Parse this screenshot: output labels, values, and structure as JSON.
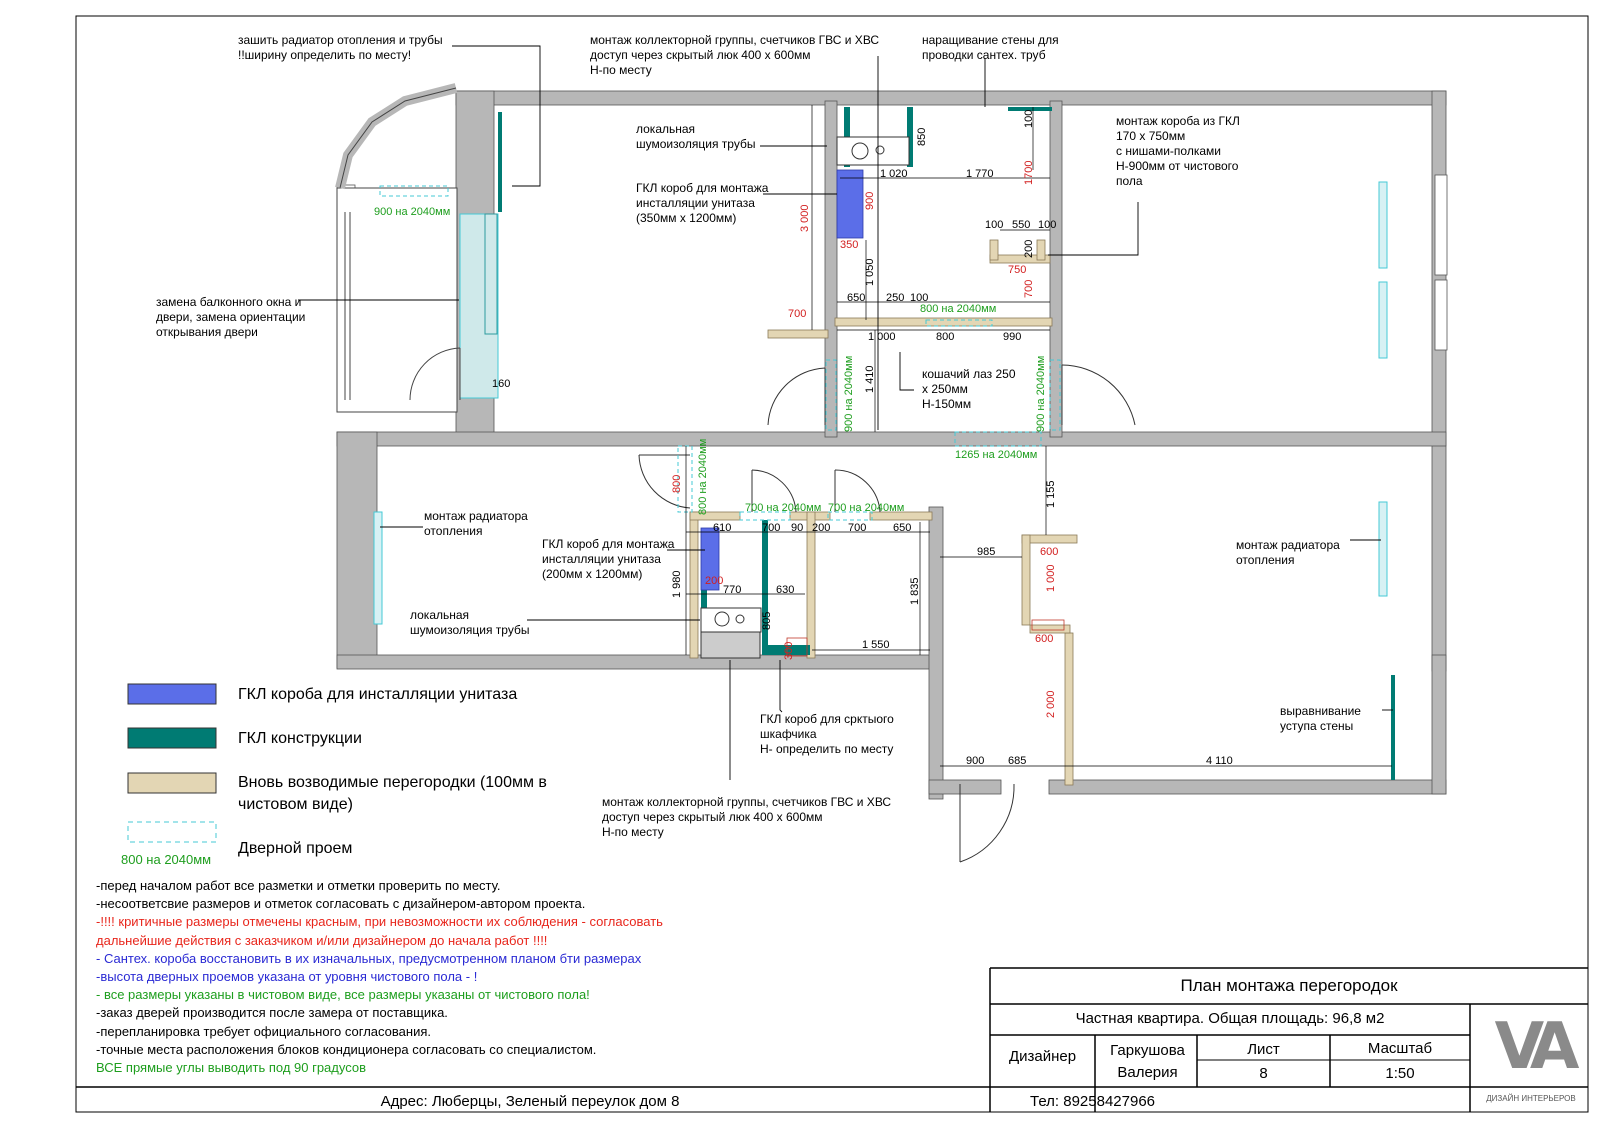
{
  "title_block": {
    "title": "План монтажа перегородок",
    "subtitle": "Частная квартира. Общая площадь: 96,8 м2",
    "designer_label": "Дизайнер",
    "designer_name": "Гаркушова Валерия",
    "sheet_label": "Лист",
    "sheet_value": "8",
    "scale_label": "Масштаб",
    "scale_value": "1:50",
    "phone": "Тел: 89258427966",
    "address": "Адрес: Люберцы, Зеленый переулок дом 8",
    "logo_text": "VA",
    "logo_caption": "ДИЗАЙН ИНТЕРЬЕРОВ"
  },
  "legend": [
    {
      "label": "ГКЛ короба для инсталляции унитаза",
      "color": "#5b6ee8"
    },
    {
      "label": "ГКЛ конструкции",
      "color": "#007b73"
    },
    {
      "label": "Вновь возводимые перегородки (100мм в чистовом виде)",
      "color": "#e3d6b4"
    },
    {
      "label": "Дверной проем",
      "color": "#45c9d6",
      "sample": "800 на 2040мм"
    }
  ],
  "notes": [
    {
      "text": "-перед началом работ все разметки и отметки проверить по месту.",
      "color": "#000000"
    },
    {
      "text": "-несоответсвие размеров и отметок согласовать с дизайнером-автором проекта.",
      "color": "#000000"
    },
    {
      "text": "-!!!! критичные размеры отмечены красным, при невозможности их соблюдения - согласовать",
      "color": "#e8261c"
    },
    {
      "text": "дальнейшие действия с заказчиком и/или дизайнером до начала работ !!!!",
      "color": "#e8261c"
    },
    {
      "text": "- Сантех. короба восстановить в их изначальных, предусмотренном планом бти размерах",
      "color": "#2a2ad4"
    },
    {
      "text": "-высота дверных проемов указана от уровня чистового пола - !",
      "color": "#2a2ad4"
    },
    {
      "text": "- все размеры указаны в чистовом виде, все размеры указаны от чистового пола!",
      "color": "#1e9e1e"
    },
    {
      "text": "-заказ дверей производится после замера от поставщика.",
      "color": "#000000"
    },
    {
      "text": "-перепланировка требует официального согласования.",
      "color": "#000000"
    },
    {
      "text": "-точные места расположения блоков кондиционера согласовать со специалистом.",
      "color": "#000000"
    },
    {
      "text": "ВСЕ прямые углы выводить под 90 градусов",
      "color": "#1e9e1e"
    }
  ],
  "annotations": {
    "radiator_sew": "зашить радиатор отопления и трубы\n!!ширину определить по месту!",
    "collector_top": "монтаж коллекторной группы, счетчиков ГВС и ХВС\nдоступ через скрытый люк 400 х 600мм\nН-по месту",
    "wall_extension": "наращивание стены для\nпроводки сантех. труб",
    "noise_top": "локальная\nшумоизоляция трубы",
    "gkl_box_top": "ГКЛ короб для монтажа\nинсталляции унитаза\n(350мм х 1200мм)",
    "gkl_box_shelves": "монтаж короба из ГКЛ\n170 х 750мм\nс нишами-полками\nН-900мм от чистового\nпола",
    "balcony": "замена балконного окна и\nдвери, замена ориентации\nоткрывания двери",
    "cat_door": "кошачий лаз 250\nх 250мм\nН-150мм",
    "radiator_left": "монтаж радиатора\nотопления",
    "gkl_box_bottom": "ГКЛ короб для монтажа\nинсталляции унитаза\n(200мм х 1200мм)",
    "noise_bottom": "локальная\nшумоизоляция трубы",
    "radiator_right": "монтаж радиатора\nотопления",
    "hidden_cabinet": "ГКЛ короб для срктыого\nшкафчика\nН- определить по месту",
    "align_wall": "выравнивание\nуступа стены",
    "collector_bottom": "монтаж коллекторной группы, счетчиков ГВС и ХВС\nдоступ через скрытый люк 400 х 600мм\nН-по месту"
  },
  "dimensions": {
    "black": [
      "1 020",
      "1 770",
      "100",
      "850",
      "100",
      "550",
      "100",
      "200",
      "650",
      "250",
      "100",
      "1 000",
      "800",
      "990",
      "1 050",
      "1 410",
      "160",
      "610",
      "700",
      "90",
      "200",
      "700",
      "650",
      "770",
      "630",
      "805",
      "1 980",
      "1 835",
      "1 550",
      "985",
      "1 155",
      "900",
      "685",
      "4 110"
    ],
    "red": [
      "900",
      "350",
      "3 000",
      "700",
      "1700",
      "750",
      "700",
      "800",
      "200",
      "300",
      "600",
      "1 000",
      "600",
      "2 000"
    ],
    "green": [
      "900 на 2040мм",
      "800 на 2040мм",
      "900 на 2040мм",
      "900 на 2040мм",
      "1265 на 2040мм",
      "800 на 2040мм",
      "700 на 2040мм",
      "700 на 2040мм"
    ]
  }
}
